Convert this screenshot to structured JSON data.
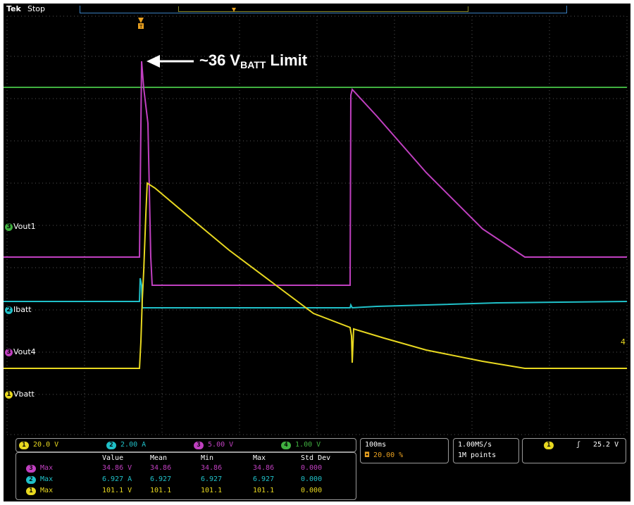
{
  "status": {
    "brand": "Tek",
    "acq_state": "Stop"
  },
  "annotation": {
    "prefix": "~36 V",
    "sub": "BATT",
    "suffix": " Limit"
  },
  "channel_labels": [
    {
      "num": "3",
      "label": "Vout1",
      "color": "#40b040"
    },
    {
      "num": "2",
      "label": "Ibatt",
      "color": "#20c0c8"
    },
    {
      "num": "3",
      "label": "Vout4",
      "color": "#c040c0"
    },
    {
      "num": "1",
      "label": "Vbatt",
      "color": "#e8d820"
    }
  ],
  "right_marker": "4",
  "scales": [
    {
      "num": "1",
      "value": "20.0 V",
      "color": "#e8d820"
    },
    {
      "num": "2",
      "value": "2.00 A",
      "color": "#20c0c8"
    },
    {
      "num": "3",
      "value": "5.00 V",
      "color": "#c040c0"
    },
    {
      "num": "4",
      "value": "1.00 V",
      "color": "#40b040"
    }
  ],
  "timebase": {
    "time": "100ms",
    "offset": "20.00 %"
  },
  "sampling": {
    "rate": "1.00MS/s",
    "points": "1M points"
  },
  "trigger": {
    "source": "1",
    "slope": "ʃ",
    "level": "25.2 V"
  },
  "measurements": {
    "headers": [
      "Value",
      "Mean",
      "Min",
      "Max",
      "Std Dev"
    ],
    "rows": [
      {
        "ch": "3",
        "label": "Max",
        "color": "#c040c0",
        "value": "34.86 V",
        "mean": "34.86",
        "min": "34.86",
        "max": "34.86",
        "std": "0.000"
      },
      {
        "ch": "2",
        "label": "Max",
        "color": "#20c0c8",
        "value": "6.927 A",
        "mean": "6.927",
        "min": "6.927",
        "max": "6.927",
        "std": "0.000"
      },
      {
        "ch": "1",
        "label": "Max",
        "color": "#e8d820",
        "value": "101.1 V",
        "mean": "101.1",
        "min": "101.1",
        "max": "101.1",
        "std": "0.000"
      }
    ]
  }
}
